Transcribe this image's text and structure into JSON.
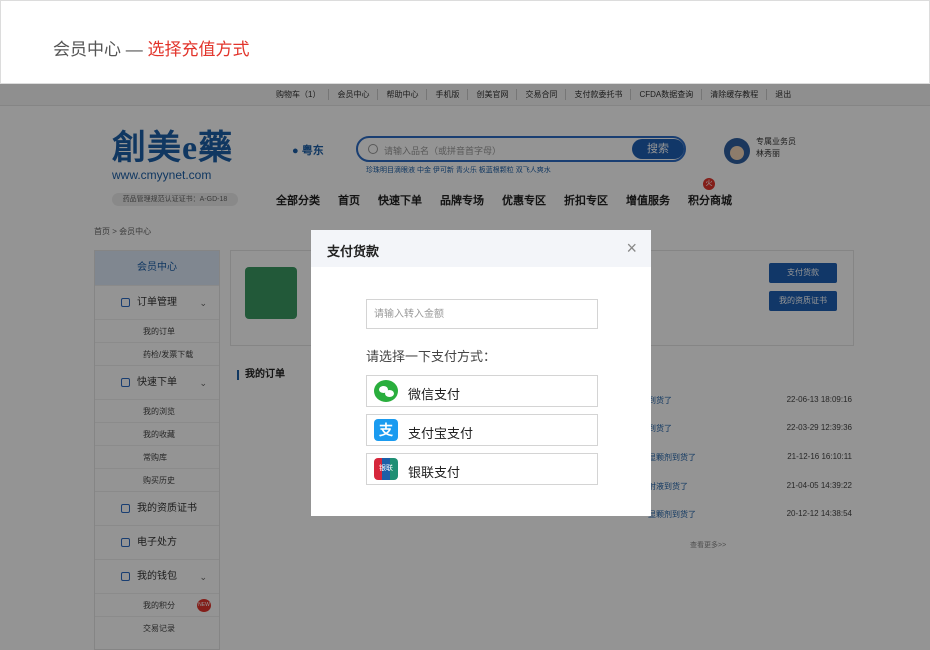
{
  "caption": {
    "prefix": "会员中心 — ",
    "highlight": "选择充值方式"
  },
  "topbar": {
    "links": [
      "购物车（1）",
      "会员中心",
      "帮助中心",
      "手机版",
      "创美官网",
      "交易合同",
      "支付款委托书",
      "CFDA数据查询",
      "清除缓存教程",
      "退出"
    ]
  },
  "header": {
    "logo_text": "創美e藥",
    "logo_url": "www.cmyynet.com",
    "cert": "药品管理规范认证证书：A-GD-18",
    "location": "粤东",
    "search_placeholder": "请输入品名（或拼音首字母）",
    "search_button": "搜索",
    "hotwords": "珍珠明目滴眼液   中金   伊可新   青火乐   板蓝根颗粒   双飞人爽水",
    "agent_title": "专属业务员",
    "agent_name": "林秀丽",
    "hot_badge": "火"
  },
  "nav": [
    "全部分类",
    "首页",
    "快速下单",
    "品牌专场",
    "优惠专区",
    "折扣专区",
    "增值服务",
    "积分商城"
  ],
  "breadcrumb": "首页 > 会员中心",
  "sidebar": {
    "head": "会员中心",
    "groups": [
      {
        "label": "订单管理",
        "chevron": "⌄",
        "subs": [
          "我的订单",
          "药检/发票下载"
        ]
      },
      {
        "label": "快速下单",
        "chevron": "⌄",
        "subs": [
          "我的浏览",
          "我的收藏",
          "常购库",
          "购买历史"
        ]
      },
      {
        "label": "我的资质证书",
        "chevron": "",
        "subs": []
      },
      {
        "label": "电子处方",
        "chevron": "",
        "subs": []
      },
      {
        "label": "我的钱包",
        "chevron": "⌄",
        "subs": [
          "我的积分",
          "交易记录"
        ]
      }
    ],
    "new_badge": "NEW"
  },
  "panel": {
    "btn_pay": "支付货款",
    "btn_cert": "我的资质证书"
  },
  "orders": {
    "title": "我的订单",
    "rows": [
      {
        "status": "到货了",
        "time": "22-06-13 18:09:16"
      },
      {
        "status": "到货了",
        "time": "22-03-29 12:39:36"
      },
      {
        "status": "显颗剂到货了",
        "time": "21-12-16 16:10:11"
      },
      {
        "status": "射液到货了",
        "time": "21-04-05 14:39:22"
      },
      {
        "status": "显颗剂到货了",
        "time": "20-12-12 14:38:54"
      }
    ],
    "more": "查看更多>>"
  },
  "modal": {
    "title": "支付货款",
    "close": "×",
    "amount_placeholder": "请输入转入金额",
    "prompt": "请选择一下支付方式：",
    "methods": [
      {
        "label": "微信支付",
        "icon": "wechat-pay-icon"
      },
      {
        "label": "支付宝支付",
        "icon": "alipay-icon",
        "glyph": "支"
      },
      {
        "label": "银联支付",
        "icon": "unionpay-icon",
        "glyph": "银联"
      }
    ]
  }
}
